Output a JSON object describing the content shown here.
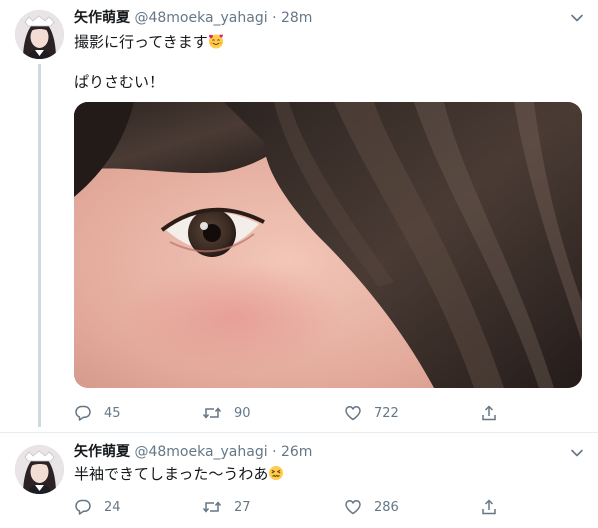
{
  "tweets": [
    {
      "name": "矢作萌夏",
      "handle": "@48moeka_yahagi",
      "separator": "·",
      "time": "28m",
      "lines": [
        "撮影に行ってきます",
        "ぱりさむい！"
      ],
      "emoji": "smiling-face-with-hearts-icon",
      "replies": "45",
      "retweets": "90",
      "likes": "722"
    },
    {
      "name": "矢作萌夏",
      "handle": "@48moeka_yahagi",
      "separator": "·",
      "time": "26m",
      "lines": [
        "半袖できてしまった〜うわあ"
      ],
      "emoji": "confounded-face-icon",
      "replies": "24",
      "retweets": "27",
      "likes": "286"
    }
  ],
  "colors": {
    "text": "#14171a",
    "muted": "#657786",
    "thread_line": "#cfd9de"
  }
}
